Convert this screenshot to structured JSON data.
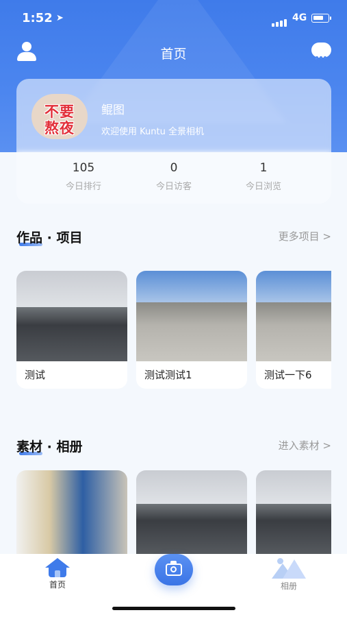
{
  "status_bar": {
    "time": "1:52",
    "network": "4G"
  },
  "header": {
    "title": "首页"
  },
  "profile": {
    "name": "鲲图",
    "welcome": "欢迎使用 Kuntu 全景相机",
    "avatar_text": [
      "不要",
      "熬夜"
    ],
    "stats": [
      {
        "value": "105",
        "label": "今日排行"
      },
      {
        "value": "0",
        "label": "今日访客"
      },
      {
        "value": "1",
        "label": "今日浏览"
      }
    ]
  },
  "projects": {
    "title": "作品 · 项目",
    "more": "更多项目 >",
    "items": [
      {
        "caption": "测试",
        "image": "office-room"
      },
      {
        "caption": "测试测试1",
        "image": "courtyard"
      },
      {
        "caption": "测试一下6",
        "image": "courtyard"
      }
    ]
  },
  "materials": {
    "title": "素材 · 相册",
    "more": "进入素材 >",
    "items": [
      {
        "image": "shop-shelves"
      },
      {
        "image": "office-room"
      },
      {
        "image": "office-room"
      }
    ]
  },
  "tabbar": {
    "items": [
      {
        "label": "首页",
        "icon": "home-icon",
        "active": true
      },
      {
        "label": "相册",
        "icon": "album-icon",
        "active": false
      }
    ],
    "center_icon": "camera-icon"
  },
  "colors": {
    "accent": "#3f7bea",
    "muted": "#999999"
  }
}
